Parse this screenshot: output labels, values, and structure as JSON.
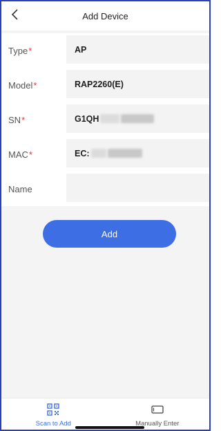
{
  "header": {
    "title": "Add Device"
  },
  "form": {
    "type": {
      "label": "Type",
      "required_mark": "*",
      "value": "AP"
    },
    "model": {
      "label": "Model",
      "required_mark": "*",
      "value": "RAP2260(E)"
    },
    "sn": {
      "label": "SN",
      "required_mark": "*",
      "value": "G1QH"
    },
    "mac": {
      "label": "MAC",
      "required_mark": "*",
      "value": "EC:"
    },
    "name": {
      "label": "Name",
      "value": ""
    }
  },
  "actions": {
    "add_label": "Add"
  },
  "tabbar": {
    "scan": {
      "label": "Scan to Add",
      "icon": "qr-code-icon",
      "active": true
    },
    "manual": {
      "label": "Manually Enter",
      "icon": "rectangle-icon",
      "active": false
    }
  },
  "colors": {
    "accent": "#3d6ee4",
    "required": "#e03a3a",
    "frame": "#2b3fb8"
  }
}
